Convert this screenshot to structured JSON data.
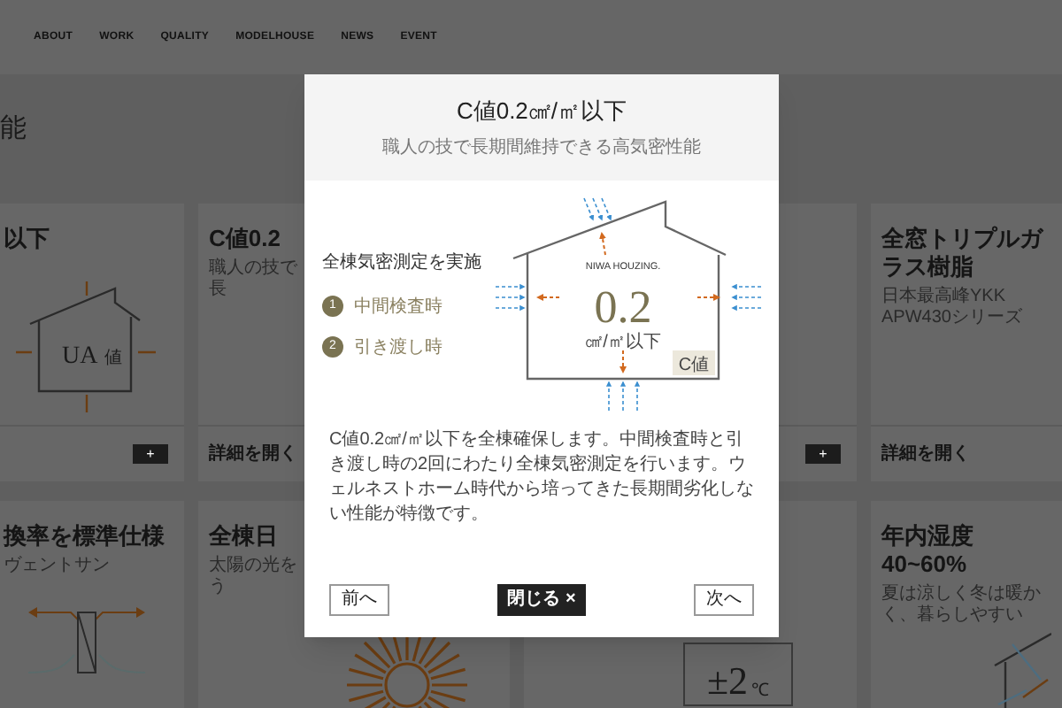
{
  "nav": [
    "ABOUT",
    "WORK",
    "QUALITY",
    "MODELHOUSE",
    "NEWS",
    "EVENT"
  ],
  "page_heading": "能",
  "card_rows": [
    [
      {
        "title": "以下",
        "figure": {
          "kind": "ua_house",
          "texts": [
            "UA",
            "値"
          ]
        },
        "plus": "+"
      },
      {
        "title": "C値0.2",
        "subtitle": "職人の技で長",
        "link": "詳細を開く"
      },
      {
        "plus": "+"
      },
      {
        "title": "全窓トリプルガラス樹脂",
        "subtitle": "日本最高峰YKK APW430シリーズ",
        "link": "詳細を開く"
      }
    ],
    [
      {
        "title": "換率を標準仕様",
        "subtitle": "ヴェントサン",
        "figure": {
          "kind": "window"
        }
      },
      {
        "title": "全棟日",
        "subtitle": "太陽の光をう",
        "figure": {
          "kind": "sun"
        }
      },
      {
        "figure": {
          "kind": "temperature",
          "texts": [
            "±2",
            "℃"
          ]
        }
      },
      {
        "title": "年内湿度40~60%",
        "subtitle": "夏は涼しく冬は暖かく、暮らしやすい",
        "figure": {
          "kind": "house"
        }
      }
    ]
  ],
  "modal": {
    "title": "C値0.2㎠/㎡以下",
    "subtitle": "職人の技で長期間維持できる高気密性能",
    "checklist": {
      "heading": "全棟気密測定を実施",
      "items": [
        {
          "number": "1",
          "label": "中間検査時"
        },
        {
          "number": "2",
          "label": "引き渡し時"
        }
      ]
    },
    "diagram": {
      "brand": "NIWA HOUZING.",
      "value": "0.2",
      "unit": "㎠/㎡以下",
      "tag": "C値"
    },
    "description": "C値0.2㎠/㎡以下を全棟確保します。中間検査時と引き渡し時の2回にわたり全棟気密測定を行います。ウェルネストホーム時代から培ってきた長期間劣化しない性能が特徴です。",
    "buttons": {
      "prev": "前へ",
      "close": "閉じる ×",
      "next": "次へ"
    }
  }
}
